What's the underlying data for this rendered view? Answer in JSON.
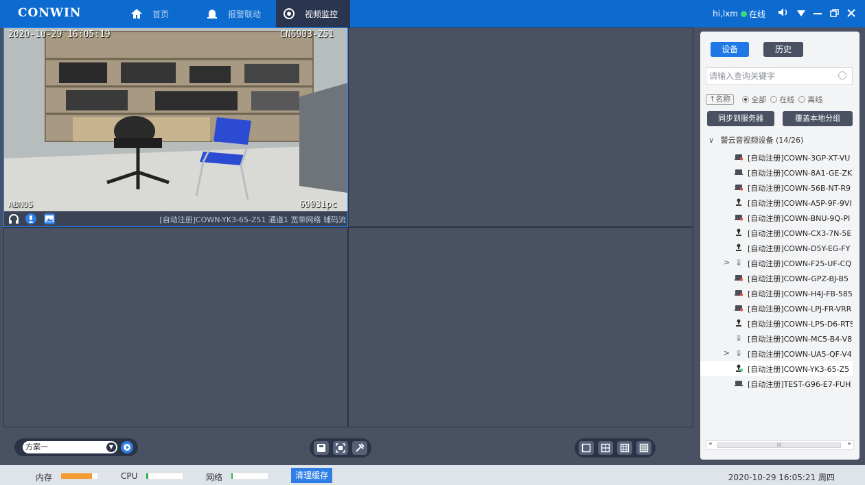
{
  "app": {
    "logo": "CONWIN"
  },
  "nav": {
    "tabs": [
      {
        "label": "首页",
        "icon": "home-icon"
      },
      {
        "label": "报警联动",
        "icon": "alarm-icon"
      },
      {
        "label": "视频监控",
        "icon": "video-monitor-icon",
        "active": true
      }
    ]
  },
  "user": {
    "greeting": "hi,lxm",
    "status": "在线"
  },
  "window_controls": [
    "volume-icon",
    "dropdown-icon",
    "minimize-icon",
    "restore-icon",
    "close-icon"
  ],
  "live_view": {
    "timestamp": "2020-10-29  16:05:19",
    "camera_id": "CN6903-Z51",
    "watermark_left": "ABNOS",
    "watermark_right": "6903ipc",
    "channel_label": "[自动注册]COWN-YK3-65-Z51 通道1 宽带网络 辅码流"
  },
  "plan": {
    "selected": "方案一"
  },
  "sidebar": {
    "tab_device": "设备",
    "tab_history": "历史",
    "search_placeholder": "请输入查询关键字",
    "sort_label": "↑名称",
    "filter_all": "全部",
    "filter_online": "在线",
    "filter_offline": "离线",
    "sync_button": "同步到服务器",
    "overwrite_button": "覆盖本地分组",
    "tree_root": "警云音视频设备 (14/26)",
    "devices": [
      {
        "label": "[自动注册]COWN-3GP-XT-VU",
        "type": "nvr",
        "status": "offline"
      },
      {
        "label": "[自动注册]COWN-8A1-GE-ZK",
        "type": "nvr",
        "status": "online"
      },
      {
        "label": "[自动注册]COWN-56B-NT-R9",
        "type": "nvr",
        "status": "offline"
      },
      {
        "label": "[自动注册]COWN-A5P-9F-9VI",
        "type": "camera",
        "status": "online"
      },
      {
        "label": "[自动注册]COWN-BNU-9Q-PI",
        "type": "nvr",
        "status": "offline"
      },
      {
        "label": "[自动注册]COWN-CX3-7N-5E",
        "type": "camera",
        "status": "online"
      },
      {
        "label": "[自动注册]COWN-D5Y-EG-FY",
        "type": "camera",
        "status": "online"
      },
      {
        "label": "[自动注册]COWN-F25-UF-CQ",
        "type": "phone",
        "status": "online",
        "expandable": true
      },
      {
        "label": "[自动注册]COWN-GPZ-BJ-B5",
        "type": "nvr",
        "status": "offline"
      },
      {
        "label": "[自动注册]COWN-H4J-FB-585",
        "type": "nvr",
        "status": "offline"
      },
      {
        "label": "[自动注册]COWN-LPJ-FR-VRR",
        "type": "nvr",
        "status": "offline"
      },
      {
        "label": "[自动注册]COWN-LPS-D6-RTS",
        "type": "camera",
        "status": "online"
      },
      {
        "label": "[自动注册]COWN-MC5-B4-V8",
        "type": "phone",
        "status": "online"
      },
      {
        "label": "[自动注册]COWN-UA5-QF-V4",
        "type": "phone",
        "status": "online",
        "expandable": true
      },
      {
        "label": "[自动注册]COWN-YK3-65-Z5",
        "type": "camera",
        "status": "playing",
        "selected": true
      },
      {
        "label": "[自动注册]TEST-G96-E7-FUH",
        "type": "nvr",
        "status": "online"
      }
    ],
    "scrollbar_grip": "III"
  },
  "status": {
    "mem_label": "内存",
    "mem_usage": 0.85,
    "cpu_label": "CPU",
    "cpu_usage": 0.06,
    "net_label": "网络",
    "net_usage": 0.02,
    "clear_button": "清理缓存",
    "datetime": "2020-10-29 16:05:21 周四"
  },
  "colors": {
    "accent": "#0d6bd0",
    "online": "#43d67a",
    "offline": "#e74c3c",
    "meter_mem": "#f39c2f",
    "meter_cpu": "#2bb34a"
  }
}
